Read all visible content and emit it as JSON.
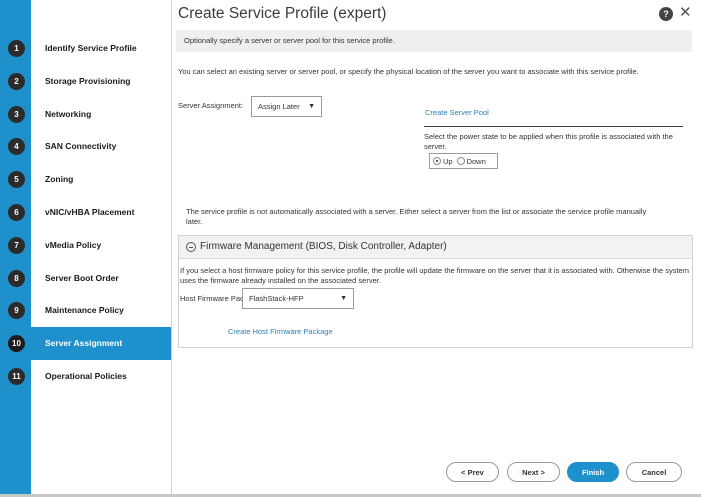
{
  "dialog": {
    "title": "Create Service Profile (expert)",
    "help_icon": "question-icon",
    "help_glyph": "?",
    "close_icon": "close-icon",
    "close_glyph": "✕"
  },
  "nav": {
    "steps": [
      {
        "num": "1",
        "label": "Identify Service Profile"
      },
      {
        "num": "2",
        "label": "Storage Provisioning"
      },
      {
        "num": "3",
        "label": "Networking"
      },
      {
        "num": "4",
        "label": "SAN Connectivity"
      },
      {
        "num": "5",
        "label": "Zoning"
      },
      {
        "num": "6",
        "label": "vNIC/vHBA Placement"
      },
      {
        "num": "7",
        "label": "vMedia Policy"
      },
      {
        "num": "8",
        "label": "Server Boot Order"
      },
      {
        "num": "9",
        "label": "Maintenance Policy"
      },
      {
        "num": "10",
        "label": "Server Assignment"
      },
      {
        "num": "11",
        "label": "Operational Policies"
      }
    ],
    "active_index": 9
  },
  "content": {
    "info": "Optionally specify a server or server pool for this service profile.",
    "intro": "You can select an existing server or server pool, or specify the physical location of the server you want to associate with this service profile.",
    "server_assignment": {
      "label": "Server Assignment:",
      "value": "Assign Later",
      "caret": "▼"
    },
    "create_server_pool": "Create Server Pool",
    "power_state_text": "Select the power state to be applied when this profile is associated with the server.",
    "power_options": {
      "up": "Up",
      "down": "Down",
      "selected": "Up"
    },
    "notice": "The service profile is not automatically associated with a server. Either select a server from the list or associate the service profile manually later.",
    "firmware": {
      "title": "Firmware Management (BIOS, Disk Controller, Adapter)",
      "collapse_icon": "minus-circle-icon",
      "text": "If you select a host firmware policy for this service profile, the profile will update the firmware on the server that it is associated with. Otherwise the system uses the firmware already installed on the associated server.",
      "package_label": "Host Firmware Package:",
      "package_value": "FlashStack-HFP",
      "caret": "▼",
      "create_link": "Create Host Firmware Package"
    }
  },
  "buttons": {
    "prev": "< Prev",
    "next": "Next >",
    "finish": "Finish",
    "cancel": "Cancel"
  },
  "colors": {
    "accent": "#1e90cc",
    "link": "#2980b9",
    "step_badge": "#2b2b2b"
  }
}
